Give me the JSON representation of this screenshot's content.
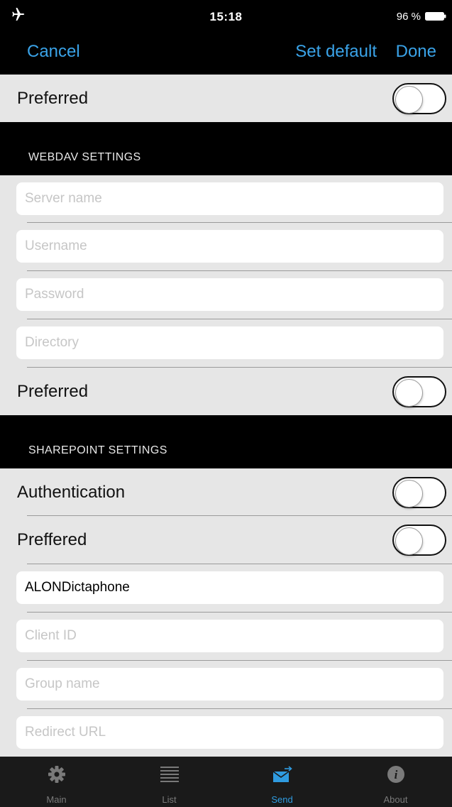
{
  "status_bar": {
    "time": "15:18",
    "battery": "96 %"
  },
  "nav": {
    "cancel": "Cancel",
    "set_default": "Set default",
    "done": "Done"
  },
  "top_row": {
    "label": "Preferred",
    "toggle_on": false
  },
  "webdav": {
    "header": "WEBDAV SETTINGS",
    "server_placeholder": "Server name",
    "username_placeholder": "Username",
    "password_placeholder": "Password",
    "directory_placeholder": "Directory",
    "preferred_label": "Preferred",
    "preferred_on": false
  },
  "sharepoint": {
    "header": "SHAREPOINT SETTINGS",
    "authentication_label": "Authentication",
    "authentication_on": false,
    "preffered_label": "Preffered",
    "preffered_on": false,
    "app_name_value": "ALONDictaphone",
    "client_id_placeholder": "Client ID",
    "group_name_placeholder": "Group name",
    "redirect_url_placeholder": "Redirect URL"
  },
  "tab_bar": {
    "tabs": [
      {
        "label": "Main",
        "icon": "gear-icon",
        "active": false
      },
      {
        "label": "List",
        "icon": "list-icon",
        "active": false
      },
      {
        "label": "Send",
        "icon": "send-mail-icon",
        "active": true
      },
      {
        "label": "About",
        "icon": "info-icon",
        "active": false
      }
    ],
    "active_color": "#2f9be0",
    "inactive_color": "#7a7a7a"
  },
  "colors": {
    "accent": "#3aa3e8",
    "background": "#e6e6e6",
    "header_bg": "#000000"
  }
}
